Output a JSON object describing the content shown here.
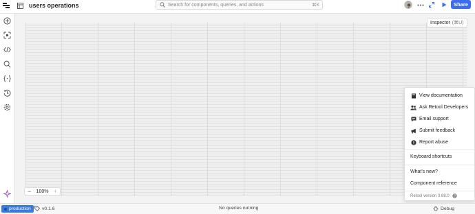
{
  "header": {
    "app_title": "users operations",
    "search_placeholder": "Search for components, queries, and actions",
    "search_shortcut": "⌘K",
    "share_label": "Share"
  },
  "sidebar": {
    "icons": [
      "plus-circle-icon",
      "components-icon",
      "code-icon",
      "search-icon",
      "braces-icon",
      "history-icon",
      "settings-icon",
      "sparkle-icon"
    ]
  },
  "canvas": {
    "inspector_label": "Inspector",
    "inspector_shortcut": "(⌘U)",
    "zoom_level": "100%",
    "zoom_minus": "−",
    "zoom_plus": "+"
  },
  "help_menu": {
    "items_top": [
      {
        "label": "View documentation",
        "icon": "book-icon"
      },
      {
        "label": "Ask Retool Developers",
        "icon": "people-icon"
      },
      {
        "label": "Email support",
        "icon": "message-icon"
      },
      {
        "label": "Submit feedback",
        "icon": "megaphone-icon"
      },
      {
        "label": "Report abuse",
        "icon": "alert-icon"
      }
    ],
    "keyboard_shortcuts": "Keyboard shortcuts",
    "whats_new": "What's new?",
    "component_reference": "Component reference",
    "version": "Retool version 3.68.0"
  },
  "statusbar": {
    "environment": "production",
    "release": "v0.1.6",
    "queries_status": "No queries running",
    "debug_label": "Debug"
  },
  "colors": {
    "accent": "#3c6cf0",
    "env_badge": "#3a7bd5",
    "sparkle": "#9b59d0"
  }
}
